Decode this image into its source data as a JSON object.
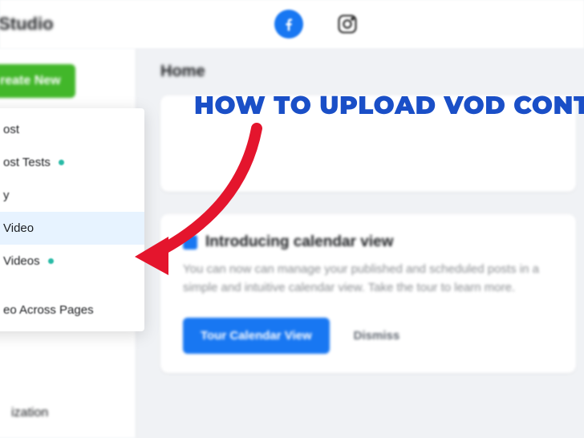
{
  "header": {
    "app_title": "or Studio"
  },
  "sidebar": {
    "create_label": "reate New",
    "items": [
      {
        "label": "ization"
      }
    ]
  },
  "dropdown": {
    "items": [
      {
        "label": "ost",
        "has_dot": false
      },
      {
        "label": "ost Tests",
        "has_dot": true
      },
      {
        "label": "y",
        "has_dot": false
      },
      {
        "label": "Video",
        "has_dot": false,
        "selected": true
      },
      {
        "label": "Videos",
        "has_dot": true
      },
      {
        "label": "eo Across Pages",
        "has_dot": false
      }
    ]
  },
  "main": {
    "home_label": "Home",
    "intro": {
      "title": "Introducing calendar view",
      "desc": "You can now can manage your published and scheduled posts in a simple and intuitive calendar view. Take the tour to learn more.",
      "tour_label": "Tour Calendar View",
      "dismiss_label": "Dismiss"
    }
  },
  "overlay": {
    "title": "HOW TO UPLOAD VOD CONTE"
  }
}
